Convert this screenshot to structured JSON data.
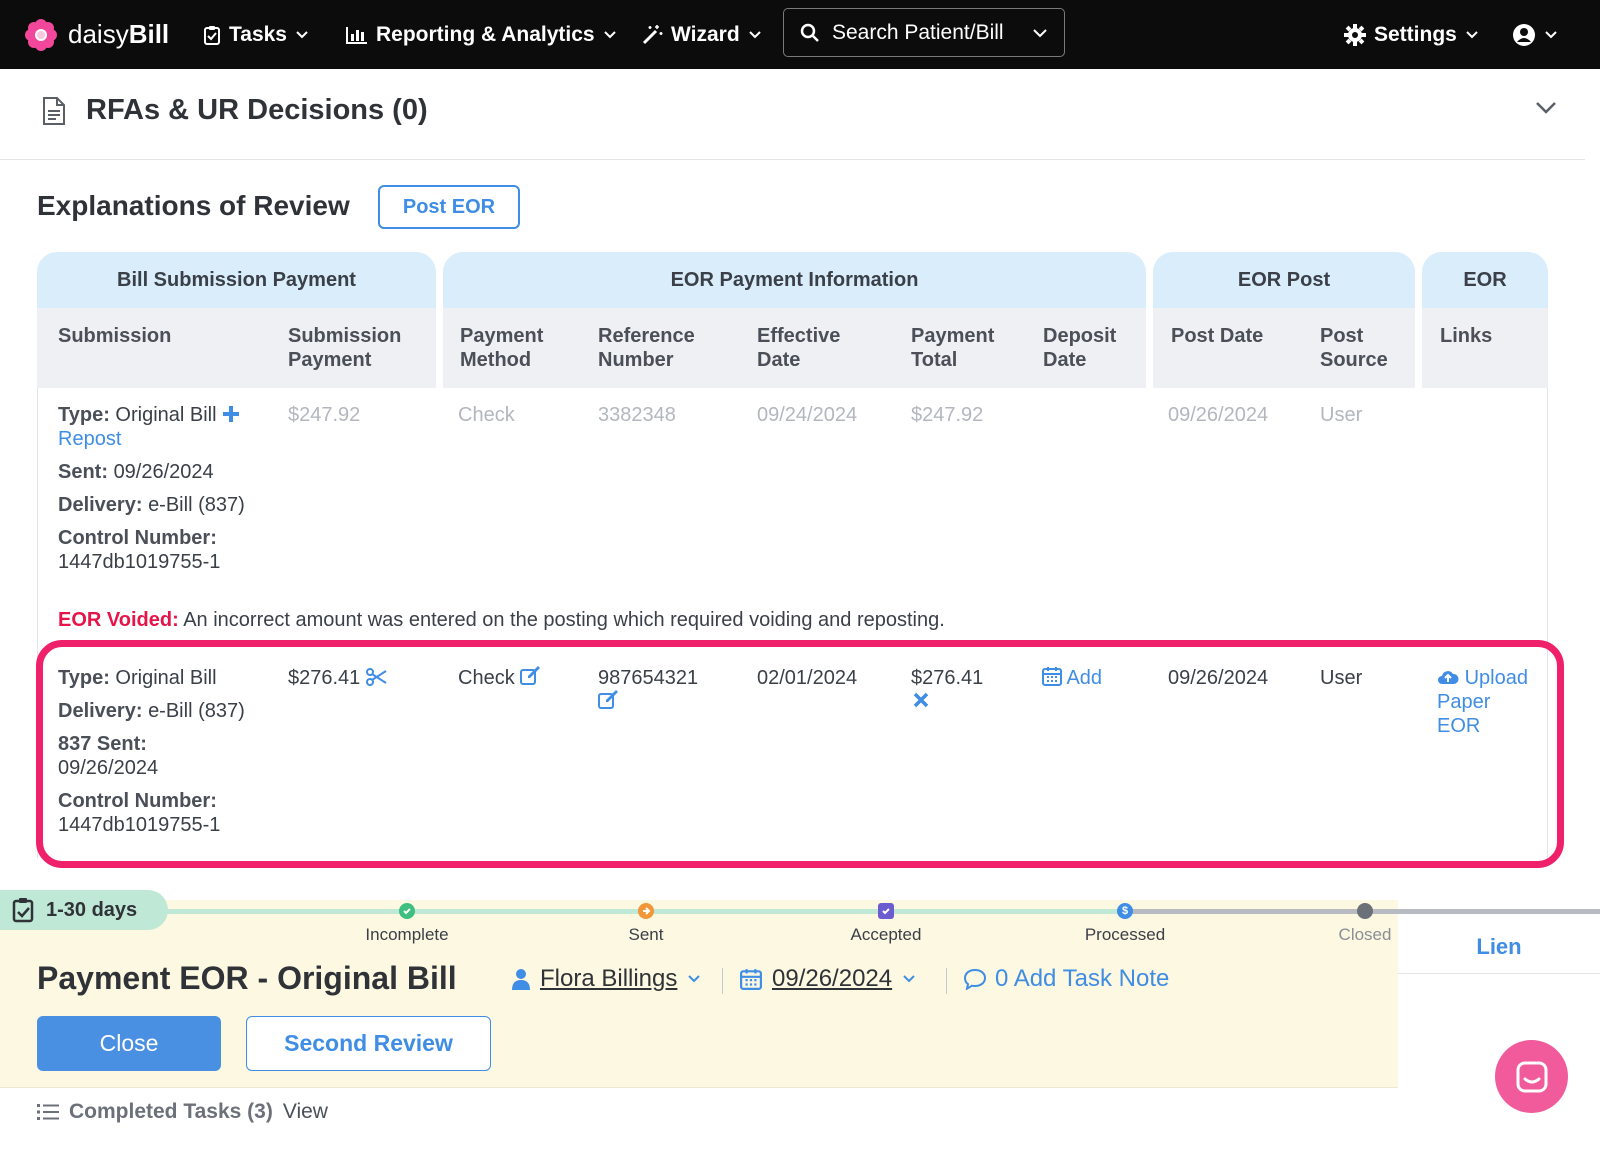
{
  "topbar": {
    "logo_text": "daisy",
    "logo_bold": "Bill",
    "nav": [
      {
        "label": "Tasks",
        "icon": "clipboard-check-icon"
      },
      {
        "label": "Reporting & Analytics",
        "icon": "bar-chart-icon"
      },
      {
        "label": "Wizard",
        "icon": "magic-wand-icon"
      }
    ],
    "search_label": "Search Patient/Bill",
    "settings_label": "Settings"
  },
  "rfa": {
    "title": "RFAs & UR Decisions (0)"
  },
  "eor": {
    "title": "Explanations of Review",
    "post_button": "Post EOR",
    "groups": [
      "Bill Submission Payment",
      "EOR Payment Information",
      "EOR Post",
      "EOR"
    ],
    "columns": [
      {
        "line1": "Submission",
        "line2": ""
      },
      {
        "line1": "Submission",
        "line2": "Payment"
      },
      {
        "line1": "Payment",
        "line2": "Method"
      },
      {
        "line1": "Reference",
        "line2": "Number"
      },
      {
        "line1": "Effective",
        "line2": "Date"
      },
      {
        "line1": "Payment",
        "line2": "Total"
      },
      {
        "line1": "Deposit",
        "line2": "Date"
      },
      {
        "line1": "Post Date",
        "line2": ""
      },
      {
        "line1": "Post",
        "line2": "Source"
      },
      {
        "line1": "Links",
        "line2": ""
      }
    ],
    "row1": {
      "type_label": "Type:",
      "type_value": "Original Bill",
      "repost_link": "Repost",
      "sent_label": "Sent:",
      "sent_value": "09/26/2024",
      "delivery_label": "Delivery:",
      "delivery_value": "e-Bill (837)",
      "control_label": "Control Number:",
      "control_value": "1447db1019755-1",
      "submission_payment": "$247.92",
      "payment_method": "Check",
      "reference_number": "3382348",
      "effective_date": "09/24/2024",
      "payment_total": "$247.92",
      "post_date": "09/26/2024",
      "post_source": "User"
    },
    "void": {
      "label": "EOR Voided:",
      "text": " An incorrect amount was entered on the posting which required voiding and reposting."
    },
    "row2": {
      "type_label": "Type:",
      "type_value": "Original Bill",
      "delivery_label": "Delivery:",
      "delivery_value": "e-Bill (837)",
      "sent_label": "837 Sent:",
      "sent_value": "09/26/2024",
      "control_label": "Control Number:",
      "control_value": "1447db1019755-1",
      "submission_payment": "$276.41",
      "payment_method": "Check",
      "reference_number": "987654321",
      "effective_date": "02/01/2024",
      "payment_total": "$276.41",
      "deposit_add": "Add",
      "post_date": "09/26/2024",
      "post_source": "User",
      "upload_link_1": "Upload",
      "upload_link_2": "Paper",
      "upload_link_3": "EOR"
    }
  },
  "task": {
    "days_badge": "1-30 days",
    "stages": [
      "Incomplete",
      "Sent",
      "Accepted",
      "Processed",
      "Closed"
    ],
    "lien_tab": "Lien",
    "title": "Payment EOR - Original Bill",
    "assignee": "Flora Billings",
    "date": "09/26/2024",
    "task_note": "0 Add Task Note",
    "close_button": "Close",
    "second_review_button": "Second Review",
    "completed_label": "Completed Tasks (3)",
    "view_link": "View"
  },
  "colors": {
    "accent": "#3f8de4",
    "highlight": "#f0216b",
    "void_red": "#e5154a",
    "task_bg": "#fdf8e1",
    "chat": "#f15a9b"
  }
}
